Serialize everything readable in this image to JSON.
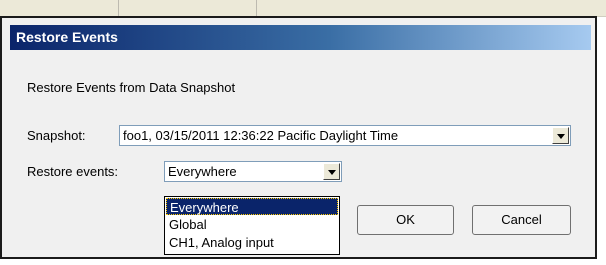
{
  "dialog": {
    "title": "Restore Events",
    "description": "Restore Events from Data Snapshot",
    "snapshot": {
      "label": "Snapshot:",
      "value": "foo1, 03/15/2011 12:36:22 Pacific Daylight Time"
    },
    "restore_events": {
      "label": "Restore events:",
      "value": "Everywhere",
      "options": [
        "Everywhere",
        "Global",
        "CH1, Analog input"
      ],
      "selected_option": "Everywhere"
    },
    "ok_label": "OK",
    "cancel_label": "Cancel"
  },
  "colors": {
    "title_bar_start": "#0a246a",
    "title_bar_end": "#a6caf0",
    "selection": "#0a246a"
  },
  "icons": [
    "dropdown-arrow-icon"
  ]
}
